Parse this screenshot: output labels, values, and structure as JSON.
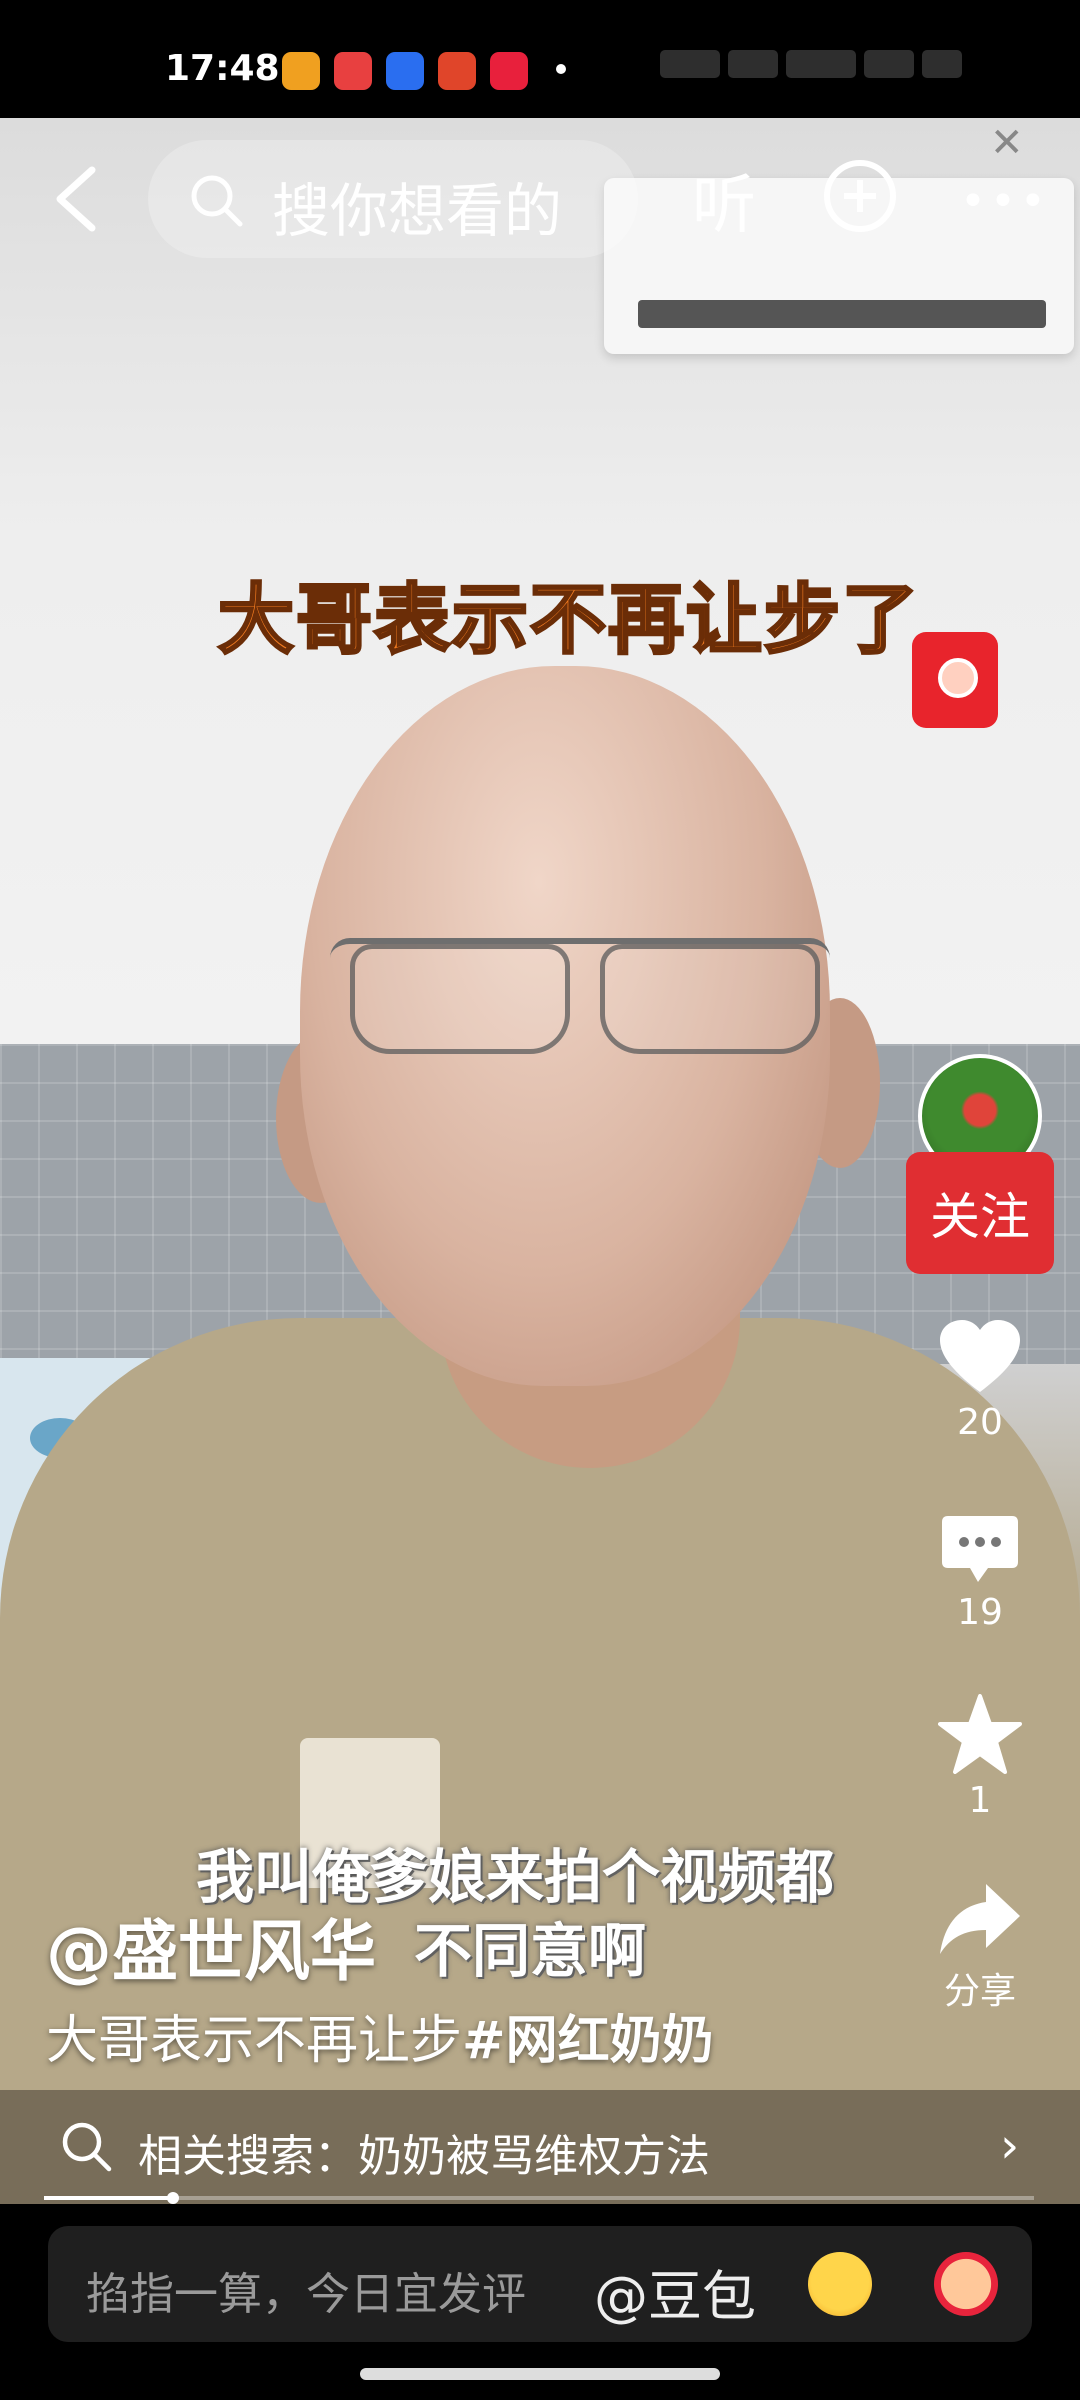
{
  "status_bar": {
    "time": "17:48",
    "app_icons": [
      {
        "name": "video-app-icon",
        "color": "#f0a020"
      },
      {
        "name": "cartoon-app-icon",
        "color": "#e84040"
      },
      {
        "name": "baidu-app-icon",
        "color": "#2a6ef0"
      },
      {
        "name": "red-app-icon",
        "color": "#e0452a"
      },
      {
        "name": "music-app-icon",
        "color": "#e8203c"
      }
    ]
  },
  "top_bar": {
    "search_placeholder": "搜你想看的",
    "listen_label": "听"
  },
  "video": {
    "caption_top": "大哥表示不再让步了",
    "subtitle_line1": "我叫俺爹娘来拍个视频都",
    "subtitle_line2": "不同意啊"
  },
  "side_rail": {
    "follow_label": "关注",
    "likes": "20",
    "comments": "19",
    "favorites": "1",
    "share_label": "分享"
  },
  "post": {
    "author": "@盛世风华",
    "description": "大哥表示不再让步",
    "hashtag": "#网红奶奶"
  },
  "related_search": {
    "text": "相关搜索：奶奶被骂维权方法"
  },
  "progress": {
    "fraction": 0.13
  },
  "comment_bar": {
    "placeholder": "掐指一算，今日宜发评",
    "mention": "@豆包"
  },
  "colors": {
    "follow_red": "#e02e32",
    "caption_orange": "#f07a20"
  }
}
